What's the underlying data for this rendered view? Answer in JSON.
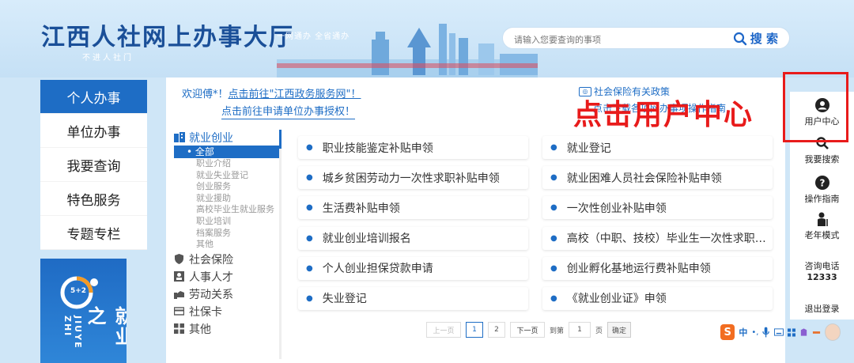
{
  "header": {
    "title": "江西人社网上办事大厅",
    "subtitle": "不进人社门",
    "slogan": "一网通办 全省通办",
    "search_placeholder": "请输入您要查询的事项",
    "search_button": "搜 索"
  },
  "left_nav": {
    "items": [
      {
        "label": "个人办事"
      },
      {
        "label": "单位办事"
      },
      {
        "label": "我要查询"
      },
      {
        "label": "特色服务"
      },
      {
        "label": "专题专栏"
      }
    ],
    "banner_text": "就业之",
    "banner_small": "JIUYE ZHI",
    "banner_logo": "5+2"
  },
  "main": {
    "welcome_prefix": "欢迎傅*！",
    "welcome_link": "点击前往\"江西政务服务网\"！",
    "auth_link": "点击前往申请单位办事授权！",
    "policy_link": "社会保险有关政策",
    "guide_link": "点击下载各项网办事项操作指南",
    "annotation": "点击用户中心"
  },
  "category_tree": {
    "head": "就业创业",
    "active_sub": "全部",
    "subs": [
      "职业介绍",
      "就业失业登记",
      "创业服务",
      "就业援助",
      "高校毕业生就业服务",
      "职业培训",
      "档案服务",
      "其他"
    ],
    "mains": [
      {
        "label": "社会保险",
        "icon": "shield-icon"
      },
      {
        "label": "人事人才",
        "icon": "person-icon"
      },
      {
        "label": "劳动关系",
        "icon": "handshake-icon"
      },
      {
        "label": "社保卡",
        "icon": "card-icon"
      },
      {
        "label": "其他",
        "icon": "grid-icon"
      }
    ]
  },
  "services": {
    "left": [
      "职业技能鉴定补贴申领",
      "城乡贫困劳动力一次性求职补贴申领",
      "生活费补贴申领",
      "就业创业培训报名",
      "个人创业担保贷款申请",
      "失业登记"
    ],
    "right": [
      "就业登记",
      "就业困难人员社会保险补贴申领",
      "一次性创业补贴申领",
      "高校（中职、技校）毕业生一次性求职补贴申领",
      "创业孵化基地运行费补贴申领",
      "《就业创业证》申领"
    ]
  },
  "pager": {
    "prev": "上一页",
    "pages": [
      "1",
      "2"
    ],
    "next": "下一页",
    "goto": "到第",
    "page_value": "1",
    "page_unit": "页",
    "confirm": "确定"
  },
  "right_bar": {
    "user_center": "用户中心",
    "search": "我要搜索",
    "guide": "操作指南",
    "elder": "老年模式",
    "phone_label": "咨询电话",
    "phone": "12333",
    "logout": "退出登录"
  },
  "ime": {
    "logo": "S",
    "lang": "中"
  },
  "colors": {
    "primary": "#1e6dc5",
    "annotation": "#e81b1b",
    "background": "#cfe6f7"
  }
}
